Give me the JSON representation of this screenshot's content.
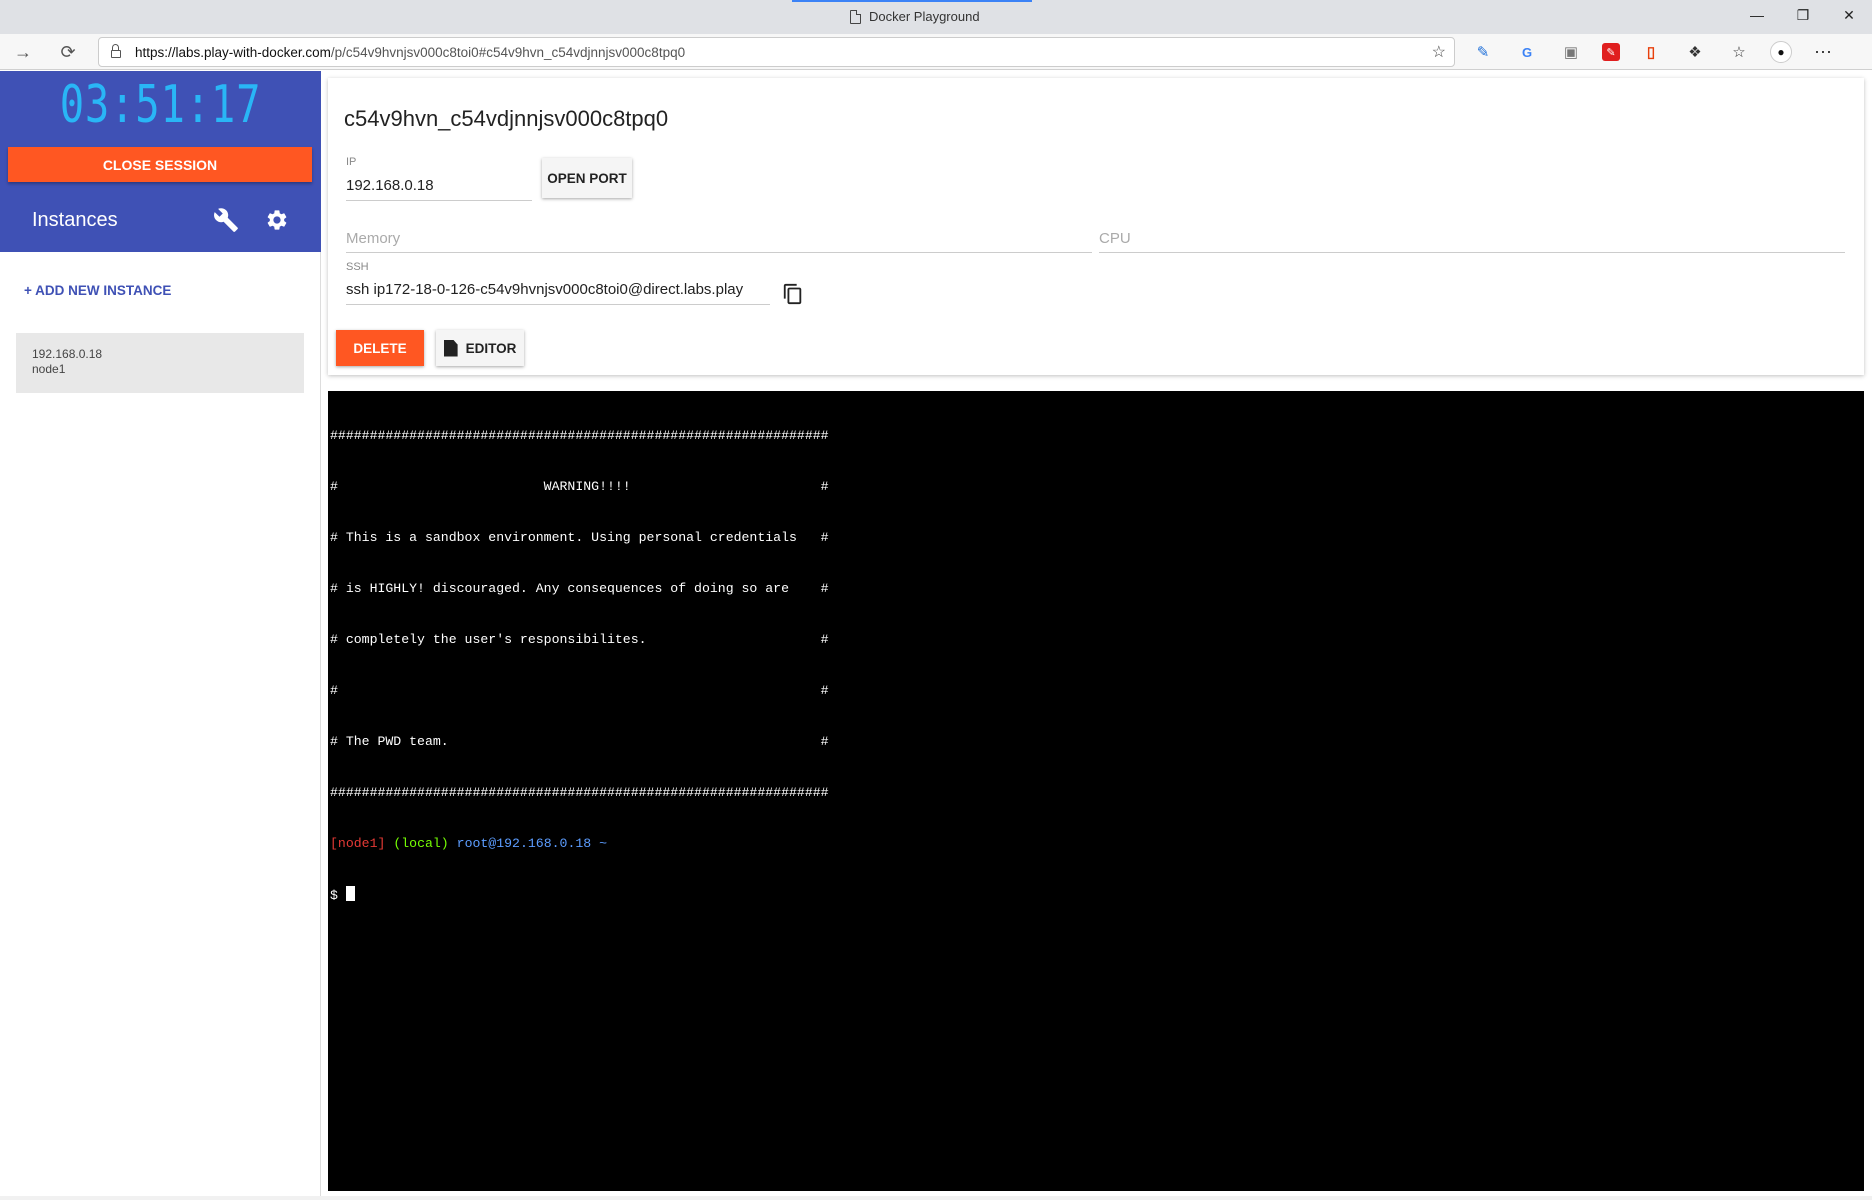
{
  "browser": {
    "tab_title": "Docker Playground",
    "url_host": "https://labs.play-with-docker.com",
    "url_path": "/p/c54v9hvnjsv000c8toi0#c54v9hvn_c54vdjnnjsv000c8tpq0",
    "window_controls": [
      "minimize-icon",
      "restore-icon",
      "close-icon"
    ],
    "extensions": [
      "pen-icon",
      "translate-icon",
      "bookmark-stack-icon",
      "pdf-icon",
      "office-icon",
      "puzzle-icon",
      "favorites-icon",
      "profile-icon",
      "more-icon"
    ]
  },
  "sidebar": {
    "timer": "03:51:17",
    "close_session_label": "CLOSE SESSION",
    "instances_title": "Instances",
    "add_instance_label": "+ ADD NEW INSTANCE",
    "instances": [
      {
        "ip": "192.168.0.18",
        "name": "node1"
      }
    ]
  },
  "instance": {
    "name": "c54v9hvn_c54vdjnnjsv000c8tpq0",
    "ip_label": "IP",
    "ip_value": "192.168.0.18",
    "open_port_label": "OPEN PORT",
    "memory_placeholder": "Memory",
    "cpu_placeholder": "CPU",
    "ssh_label": "SSH",
    "ssh_value": "ssh ip172-18-0-126-c54v9hvnjsv000c8toi0@direct.labs.play",
    "delete_label": "DELETE",
    "editor_label": "EDITOR"
  },
  "terminal": {
    "lines": [
      "###############################################################",
      "#                          WARNING!!!!                        #",
      "# This is a sandbox environment. Using personal credentials   #",
      "# is HIGHLY! discouraged. Any consequences of doing so are    #",
      "# completely the user's responsibilites.                      #",
      "#                                                             #",
      "# The PWD team.                                               #",
      "###############################################################"
    ],
    "prompt_node": "[node1]",
    "prompt_env": "(local)",
    "prompt_user": "root@192.168.0.18 ~",
    "prompt_symbol": "$ "
  },
  "colors": {
    "sidebar_header": "#3f51b5",
    "accent_orange": "#ff5722",
    "timer": "#29b6f6"
  }
}
